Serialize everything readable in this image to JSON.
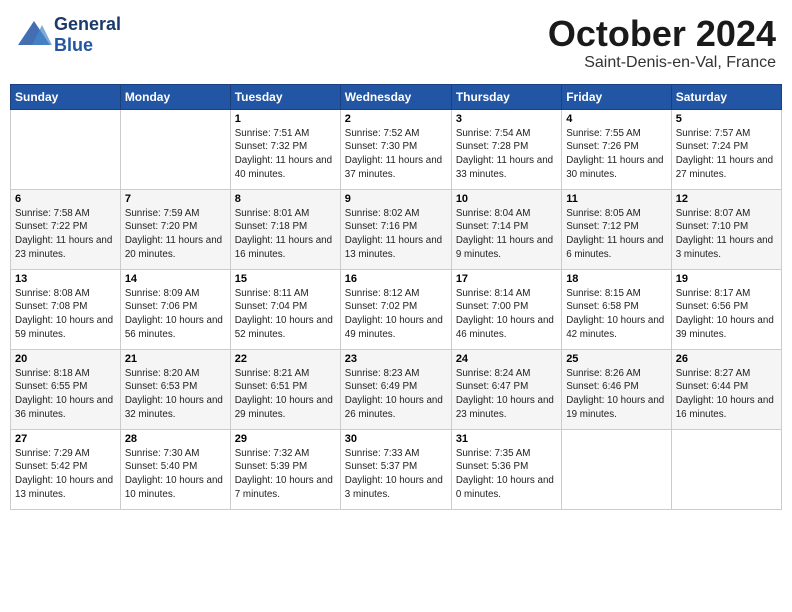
{
  "header": {
    "logo_text_general": "General",
    "logo_text_blue": "Blue",
    "month_title": "October 2024",
    "location": "Saint-Denis-en-Val, France"
  },
  "days_of_week": [
    "Sunday",
    "Monday",
    "Tuesday",
    "Wednesday",
    "Thursday",
    "Friday",
    "Saturday"
  ],
  "weeks": [
    [
      {
        "day": "",
        "info": ""
      },
      {
        "day": "",
        "info": ""
      },
      {
        "day": "1",
        "sunrise": "7:51 AM",
        "sunset": "7:32 PM",
        "daylight": "11 hours and 40 minutes."
      },
      {
        "day": "2",
        "sunrise": "7:52 AM",
        "sunset": "7:30 PM",
        "daylight": "11 hours and 37 minutes."
      },
      {
        "day": "3",
        "sunrise": "7:54 AM",
        "sunset": "7:28 PM",
        "daylight": "11 hours and 33 minutes."
      },
      {
        "day": "4",
        "sunrise": "7:55 AM",
        "sunset": "7:26 PM",
        "daylight": "11 hours and 30 minutes."
      },
      {
        "day": "5",
        "sunrise": "7:57 AM",
        "sunset": "7:24 PM",
        "daylight": "11 hours and 27 minutes."
      }
    ],
    [
      {
        "day": "6",
        "sunrise": "7:58 AM",
        "sunset": "7:22 PM",
        "daylight": "11 hours and 23 minutes."
      },
      {
        "day": "7",
        "sunrise": "7:59 AM",
        "sunset": "7:20 PM",
        "daylight": "11 hours and 20 minutes."
      },
      {
        "day": "8",
        "sunrise": "8:01 AM",
        "sunset": "7:18 PM",
        "daylight": "11 hours and 16 minutes."
      },
      {
        "day": "9",
        "sunrise": "8:02 AM",
        "sunset": "7:16 PM",
        "daylight": "11 hours and 13 minutes."
      },
      {
        "day": "10",
        "sunrise": "8:04 AM",
        "sunset": "7:14 PM",
        "daylight": "11 hours and 9 minutes."
      },
      {
        "day": "11",
        "sunrise": "8:05 AM",
        "sunset": "7:12 PM",
        "daylight": "11 hours and 6 minutes."
      },
      {
        "day": "12",
        "sunrise": "8:07 AM",
        "sunset": "7:10 PM",
        "daylight": "11 hours and 3 minutes."
      }
    ],
    [
      {
        "day": "13",
        "sunrise": "8:08 AM",
        "sunset": "7:08 PM",
        "daylight": "10 hours and 59 minutes."
      },
      {
        "day": "14",
        "sunrise": "8:09 AM",
        "sunset": "7:06 PM",
        "daylight": "10 hours and 56 minutes."
      },
      {
        "day": "15",
        "sunrise": "8:11 AM",
        "sunset": "7:04 PM",
        "daylight": "10 hours and 52 minutes."
      },
      {
        "day": "16",
        "sunrise": "8:12 AM",
        "sunset": "7:02 PM",
        "daylight": "10 hours and 49 minutes."
      },
      {
        "day": "17",
        "sunrise": "8:14 AM",
        "sunset": "7:00 PM",
        "daylight": "10 hours and 46 minutes."
      },
      {
        "day": "18",
        "sunrise": "8:15 AM",
        "sunset": "6:58 PM",
        "daylight": "10 hours and 42 minutes."
      },
      {
        "day": "19",
        "sunrise": "8:17 AM",
        "sunset": "6:56 PM",
        "daylight": "10 hours and 39 minutes."
      }
    ],
    [
      {
        "day": "20",
        "sunrise": "8:18 AM",
        "sunset": "6:55 PM",
        "daylight": "10 hours and 36 minutes."
      },
      {
        "day": "21",
        "sunrise": "8:20 AM",
        "sunset": "6:53 PM",
        "daylight": "10 hours and 32 minutes."
      },
      {
        "day": "22",
        "sunrise": "8:21 AM",
        "sunset": "6:51 PM",
        "daylight": "10 hours and 29 minutes."
      },
      {
        "day": "23",
        "sunrise": "8:23 AM",
        "sunset": "6:49 PM",
        "daylight": "10 hours and 26 minutes."
      },
      {
        "day": "24",
        "sunrise": "8:24 AM",
        "sunset": "6:47 PM",
        "daylight": "10 hours and 23 minutes."
      },
      {
        "day": "25",
        "sunrise": "8:26 AM",
        "sunset": "6:46 PM",
        "daylight": "10 hours and 19 minutes."
      },
      {
        "day": "26",
        "sunrise": "8:27 AM",
        "sunset": "6:44 PM",
        "daylight": "10 hours and 16 minutes."
      }
    ],
    [
      {
        "day": "27",
        "sunrise": "7:29 AM",
        "sunset": "5:42 PM",
        "daylight": "10 hours and 13 minutes."
      },
      {
        "day": "28",
        "sunrise": "7:30 AM",
        "sunset": "5:40 PM",
        "daylight": "10 hours and 10 minutes."
      },
      {
        "day": "29",
        "sunrise": "7:32 AM",
        "sunset": "5:39 PM",
        "daylight": "10 hours and 7 minutes."
      },
      {
        "day": "30",
        "sunrise": "7:33 AM",
        "sunset": "5:37 PM",
        "daylight": "10 hours and 3 minutes."
      },
      {
        "day": "31",
        "sunrise": "7:35 AM",
        "sunset": "5:36 PM",
        "daylight": "10 hours and 0 minutes."
      },
      {
        "day": "",
        "info": ""
      },
      {
        "day": "",
        "info": ""
      }
    ]
  ],
  "labels": {
    "sunrise": "Sunrise:",
    "sunset": "Sunset:",
    "daylight": "Daylight:"
  }
}
